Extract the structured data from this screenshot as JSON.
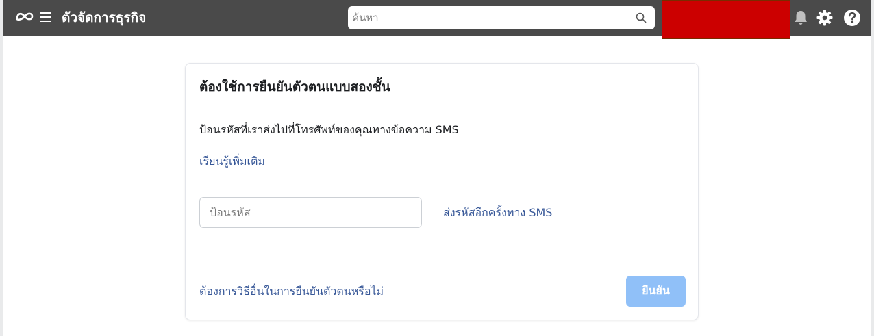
{
  "header": {
    "app_title": "ตัวจัดการธุรกิจ",
    "search_placeholder": "ค้นหา",
    "redaction_color": "#cc0000",
    "background_color": "#4a4a4a",
    "icons": [
      "meta-logo-icon",
      "hamburger-menu-icon",
      "search-icon",
      "bell-icon",
      "gear-icon",
      "help-icon"
    ]
  },
  "card": {
    "title": "ต้องใช้การยืนยันตัวตนแบบสองชั้น",
    "description": "ป้อนรหัสที่เราส่งไปที่โทรศัพท์ของคุณทางข้อความ SMS",
    "learn_more": "เรียนรู้เพิ่มเติม",
    "code_placeholder": "ป้อนรหัส",
    "code_value": "",
    "resend_link": "ส่งรหัสอีกครั้งทาง SMS",
    "other_method_link": "ต้องการวิธีอื่นในการยืนยันตัวตนหรือไม่",
    "confirm_button": "ยืนยัน",
    "link_color": "#385898",
    "button_color": "#90c0f8"
  }
}
